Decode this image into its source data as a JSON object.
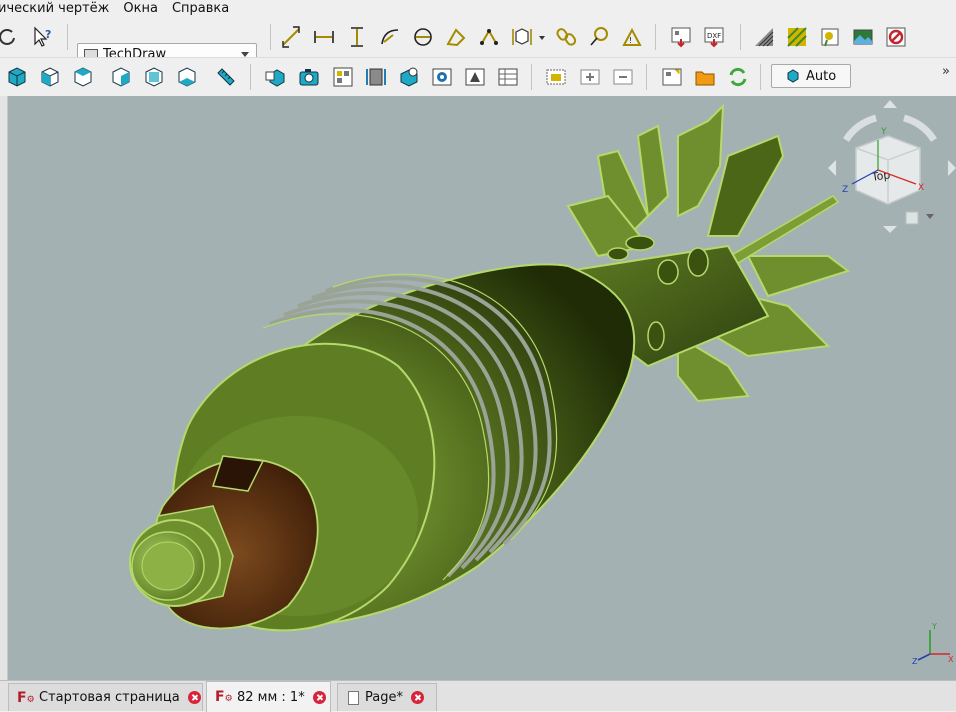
{
  "menu": {
    "items": [
      {
        "label": "ический чертёж"
      },
      {
        "label": "Окна"
      },
      {
        "label": "Справка"
      }
    ]
  },
  "workbench": {
    "selected": "TechDraw",
    "icon": "techdraw-icon"
  },
  "toolbar": {
    "auto_label": "Auto",
    "overflow_label": "»"
  },
  "tabs": [
    {
      "label": "Стартовая страница",
      "icon": "freecad-logo-icon",
      "active": false
    },
    {
      "label": "82 мм : 1*",
      "icon": "freecad-logo-icon",
      "active": true
    },
    {
      "label": "Page*",
      "icon": "page-icon",
      "active": false
    }
  ],
  "navcube": {
    "face_label": "Top",
    "axes": {
      "x": "X",
      "y": "Y",
      "z": "Z"
    }
  },
  "colors": {
    "viewport_bg": "#a4b1b2",
    "model_green": "#6f8f2e",
    "model_edge": "#b5d96a",
    "nose_brown": "#6e3a17"
  }
}
